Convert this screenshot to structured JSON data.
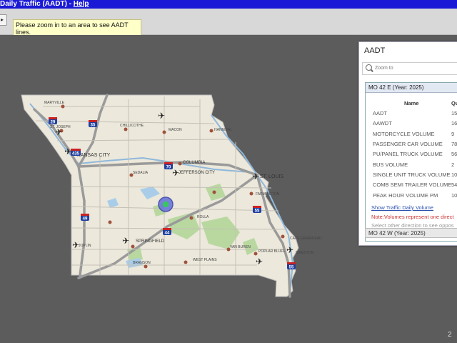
{
  "titlebar": {
    "title": "Daily Traffic (AADT)",
    "separator": " - ",
    "help": "Help"
  },
  "toolbar": {
    "button_glyph": "▸",
    "message": "Please zoom in to an area to see AADT lines."
  },
  "panel": {
    "title": "AADT",
    "search_placeholder": "Zoom to",
    "card_title": "MO 42 E (Year: 2025)",
    "columns": {
      "name": "Name",
      "qty": "Qu"
    },
    "rows": [
      {
        "label": "AADT",
        "value": "15"
      },
      {
        "label": "AAWDT",
        "value": "16"
      },
      {
        "label": "MOTORCYCLE VOLUME",
        "value": "9"
      },
      {
        "label": "PASSENGER CAR VOLUME",
        "value": "78"
      },
      {
        "label": "PU/PANEL TRUCK VOLUME",
        "value": "56"
      },
      {
        "label": "BUS VOLUME",
        "value": "2"
      },
      {
        "label": "SINGLE UNIT TRUCK VOLUME",
        "value": "10"
      },
      {
        "label": "COMB SEMI TRAILER VOLUME",
        "value": "54"
      },
      {
        "label": "PEAK HOUR VOLUME PM",
        "value": "10"
      }
    ],
    "link": "Show Traffic Daily Volume",
    "note": "Note:Volumes represent one direct",
    "note2": "Select other direction to see oppos",
    "footer": "MO 42 W (Year: 2025)"
  },
  "map": {
    "cities": [
      "MARYVILLE",
      "ST. JOSEPH",
      "CHILLICOTHE",
      "MACON",
      "HANNIBAL",
      "KANSAS CITY",
      "COLUMBIA",
      "JEFFERSON CITY",
      "SEDALIA",
      "ST. LOUIS",
      "SPRINGFIELD",
      "JOPLIN",
      "ROLLA",
      "FARMINGTON",
      "CAPE GIRARDEAU",
      "WEST PLAINS",
      "VAN BUREN",
      "POPLAR BLUFF",
      "BRANSON",
      "SIKESTON"
    ],
    "shields": [
      "29",
      "35",
      "435",
      "70",
      "44",
      "49",
      "55",
      "55"
    ]
  },
  "corner_text": "2"
}
